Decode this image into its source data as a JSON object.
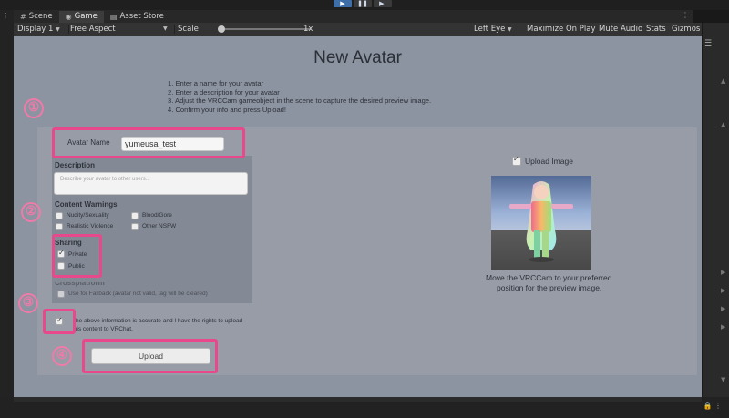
{
  "toolbar": {
    "play": "▶",
    "pause": "❚❚",
    "step": "▶|"
  },
  "tabs": [
    {
      "icon": "#",
      "label": "Scene"
    },
    {
      "icon": "◉",
      "label": "Game"
    },
    {
      "icon": "▤",
      "label": "Asset Store"
    }
  ],
  "gamebar": {
    "display": "Display 1",
    "aspect": "Free Aspect",
    "scale_label": "Scale",
    "scale_value": "1x",
    "eye": "Left Eye",
    "maximize": "Maximize On Play",
    "mute": "Mute Audio",
    "stats": "Stats",
    "gizmos": "Gizmos"
  },
  "page": {
    "title": "New Avatar",
    "instructions": [
      "1. Enter a name for your avatar",
      "2. Enter a description for your avatar",
      "3. Adjust the VRCCam gameobject in the scene to capture the desired preview image.",
      "4. Confirm your info and press Upload!"
    ]
  },
  "form": {
    "name_label": "Avatar Name",
    "name_value": "yumeusa_test",
    "description_label": "Description",
    "description_placeholder": "Describe your avatar to other users...",
    "content_warnings_label": "Content Warnings",
    "warnings": {
      "nudity": "Nudity/Sexuality",
      "blood": "Blood/Gore",
      "violence": "Realistic Violence",
      "nsfw": "Other NSFW"
    },
    "sharing_label": "Sharing",
    "private_label": "Private",
    "public_label": "Public",
    "crossplatform_label": "Crossplatform",
    "fallback_label": "Use for Fallback (avatar not valid, tag will be cleared)",
    "confirm_line1": "The above information is accurate and I have the rights to upload",
    "confirm_line2": "this content to VRChat.",
    "upload_label": "Upload"
  },
  "preview": {
    "upload_image_label": "Upload Image",
    "caption_line1": "Move the VRCCam to your preferred",
    "caption_line2": "position for the preview image."
  },
  "annotations": [
    "①",
    "②",
    "③",
    "④"
  ],
  "colors": {
    "annotation_pink": "#e8488c"
  }
}
